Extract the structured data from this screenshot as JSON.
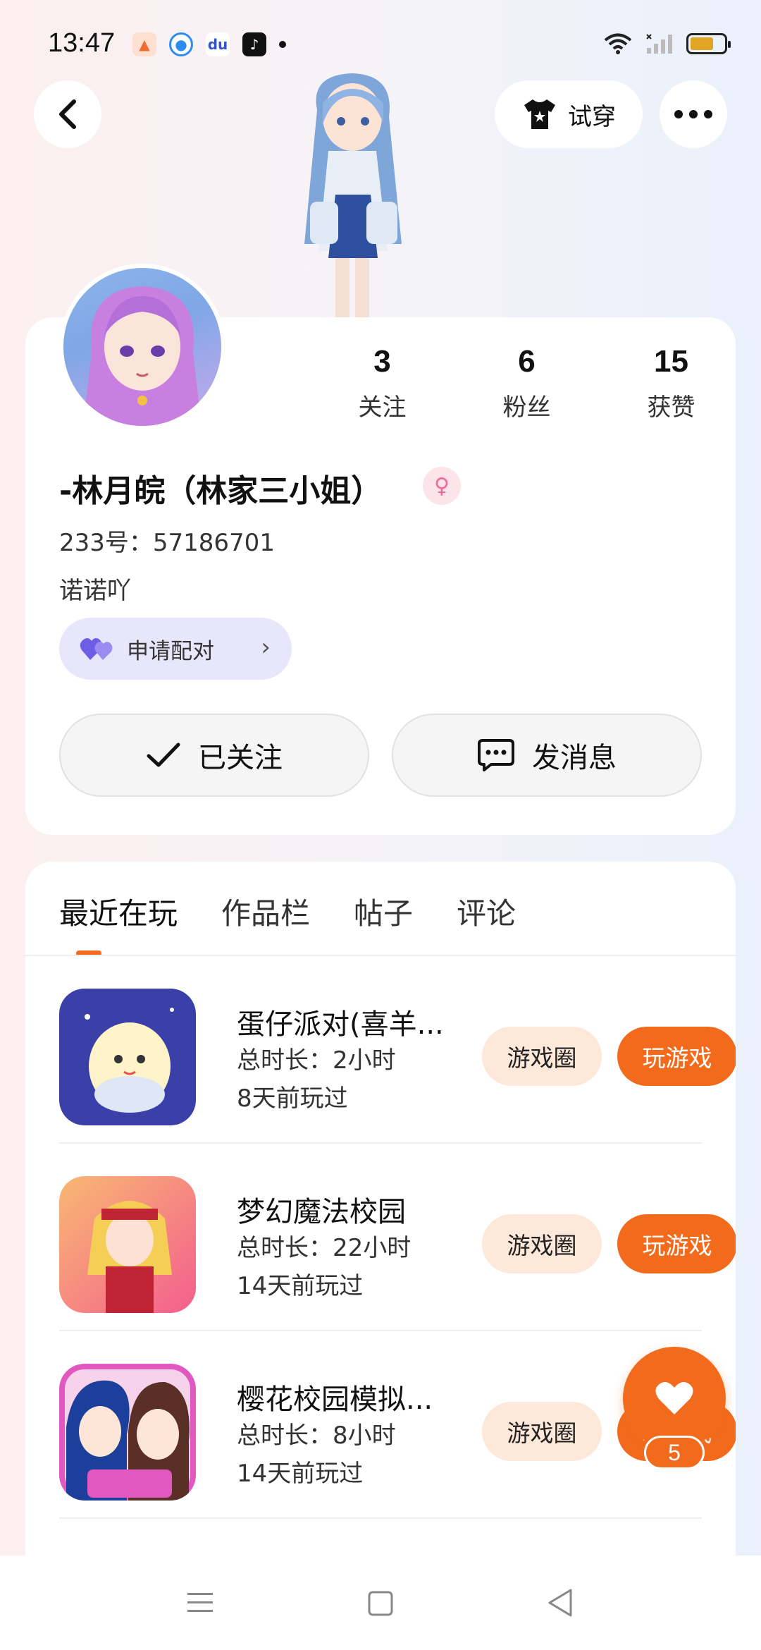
{
  "status_bar": {
    "time": "13:47"
  },
  "header": {
    "tryon_label": "试穿"
  },
  "profile": {
    "stats": [
      {
        "value": "3",
        "label": "关注"
      },
      {
        "value": "6",
        "label": "粉丝"
      },
      {
        "value": "15",
        "label": "获赞"
      }
    ],
    "username": "-林月皖（林家三小姐）",
    "id_text": "233号：57186701",
    "bio": "诺诺吖",
    "pair_label": "申请配对",
    "follow_label": "已关注",
    "message_label": "发消息"
  },
  "tabs": [
    {
      "label": "最近在玩",
      "active": true
    },
    {
      "label": "作品栏",
      "active": false
    },
    {
      "label": "帖子",
      "active": false
    },
    {
      "label": "评论",
      "active": false
    }
  ],
  "games": [
    {
      "name": "蛋仔派对(喜羊...",
      "total_time": "总时长：2小时",
      "last_played": "8天前玩过",
      "circle_label": "游戏圈",
      "play_label": "玩游戏"
    },
    {
      "name": "梦幻魔法校园",
      "total_time": "总时长：22小时",
      "last_played": "14天前玩过",
      "circle_label": "游戏圈",
      "play_label": "玩游戏"
    },
    {
      "name": "樱花校园模拟...",
      "total_time": "总时长：8小时",
      "last_played": "14天前玩过",
      "circle_label": "游戏圈",
      "play_label": "玩游戏"
    }
  ],
  "like": {
    "count": "5"
  },
  "colors": {
    "accent": "#f26b1d",
    "accent_light": "#fde8da",
    "pair_bg": "#e8e6fb"
  }
}
